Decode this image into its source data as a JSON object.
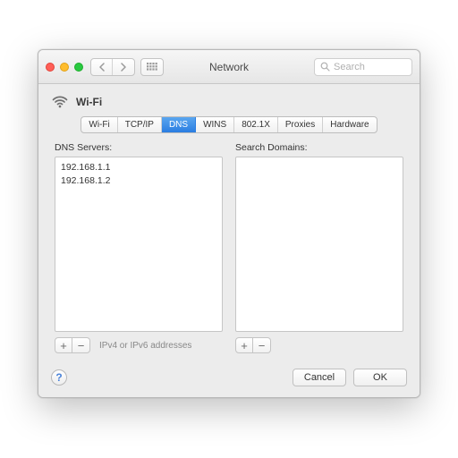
{
  "window": {
    "title": "Network",
    "search_placeholder": "Search"
  },
  "connection": {
    "name": "Wi-Fi"
  },
  "tabs": [
    {
      "label": "Wi-Fi",
      "selected": false
    },
    {
      "label": "TCP/IP",
      "selected": false
    },
    {
      "label": "DNS",
      "selected": true
    },
    {
      "label": "WINS",
      "selected": false
    },
    {
      "label": "802.1X",
      "selected": false
    },
    {
      "label": "Proxies",
      "selected": false
    },
    {
      "label": "Hardware",
      "selected": false
    }
  ],
  "dns_panel": {
    "servers_label": "DNS Servers:",
    "servers": [
      "192.168.1.1",
      "192.168.1.2"
    ],
    "servers_hint": "IPv4 or IPv6 addresses",
    "domains_label": "Search Domains:",
    "domains": []
  },
  "buttons": {
    "cancel": "Cancel",
    "ok": "OK"
  }
}
